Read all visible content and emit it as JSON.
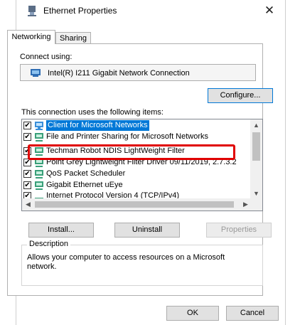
{
  "window": {
    "title": "Ethernet Properties",
    "close_glyph": "✕"
  },
  "tabs": [
    {
      "label": "Networking",
      "active": true
    },
    {
      "label": "Sharing",
      "active": false
    }
  ],
  "connect_using": {
    "label": "Connect using:",
    "adapter": "Intel(R) I211 Gigabit Network Connection",
    "configure_label": "Configure..."
  },
  "items_label": "This connection uses the following items:",
  "items": [
    {
      "label": "Client for Microsoft Networks",
      "checked": true,
      "selected": true,
      "icon": "network-client-icon"
    },
    {
      "label": "File and Printer Sharing for Microsoft Networks",
      "checked": true,
      "selected": false,
      "icon": "network-service-icon"
    },
    {
      "label": "Techman Robot NDIS LightWeight Filter",
      "checked": true,
      "selected": false,
      "icon": "network-filter-icon"
    },
    {
      "label": "Point Grey Lightweight Filter Driver 09/11/2019, 2.7.3.2",
      "checked": true,
      "selected": false,
      "icon": "network-filter-icon"
    },
    {
      "label": "QoS Packet Scheduler",
      "checked": true,
      "selected": false,
      "icon": "network-service-icon"
    },
    {
      "label": "Gigabit Ethernet uEye",
      "checked": true,
      "selected": false,
      "icon": "network-service-icon"
    },
    {
      "label": "Internet Protocol Version 4 (TCP/IPv4)",
      "checked": true,
      "selected": false,
      "icon": "protocol-icon"
    }
  ],
  "buttons": {
    "install": "Install...",
    "uninstall": "Uninstall",
    "properties": "Properties",
    "ok": "OK",
    "cancel": "Cancel"
  },
  "description": {
    "title": "Description",
    "text": "Allows your computer to access resources on a Microsoft network."
  },
  "colors": {
    "selection": "#0078d7",
    "highlight_box": "#e00000"
  }
}
